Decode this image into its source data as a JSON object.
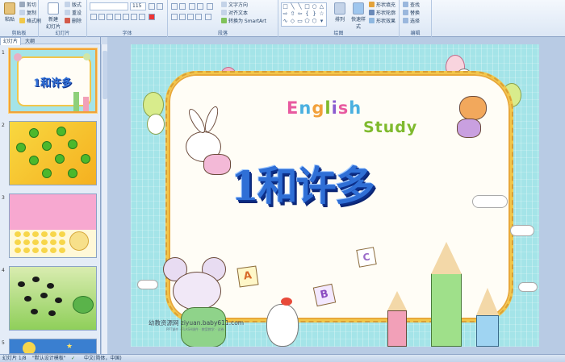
{
  "ribbon": {
    "clipboard": {
      "paste": "粘贴",
      "cut": "剪切",
      "copy": "复制",
      "format_painter": "格式刷",
      "label": "剪贴板"
    },
    "slides": {
      "new_slide": "新建\n幻灯片",
      "layout": "版式",
      "reset": "重设",
      "delete": "删除",
      "label": "幻灯片"
    },
    "font": {
      "size": "115",
      "label": "字体"
    },
    "paragraph": {
      "text_direction": "文字方向",
      "align_text": "对齐文本",
      "smartart": "转换为 SmartArt",
      "label": "段落"
    },
    "drawing": {
      "arrange": "排列",
      "quick_styles": "快速样式",
      "shape_fill": "形状填充",
      "shape_outline": "形状轮廓",
      "shape_effects": "形状效果",
      "label": "绘图"
    },
    "editing": {
      "find": "查找",
      "replace": "替换",
      "select": "选择",
      "label": "编辑"
    }
  },
  "pane": {
    "tabs": [
      "幻灯片",
      "大纲"
    ],
    "thumbnails": [
      {
        "num": "1",
        "title": "1和许多"
      },
      {
        "num": "2"
      },
      {
        "num": "3"
      },
      {
        "num": "4"
      },
      {
        "num": "5"
      }
    ]
  },
  "slide": {
    "english": "English",
    "study": "Study",
    "title": "1和许多",
    "cards": [
      "A",
      "B",
      "C"
    ],
    "watermark": "幼教资源网 ziyuan.baby611.com",
    "watermark_sub": "PPT课件 · FLASH课件 · 教案教学 · 试卷"
  },
  "status": {
    "slide_info": "幻灯片 1/8",
    "theme": "\"默认设计模板\"",
    "language": "中文(简体，中国)"
  },
  "colors": {
    "accent": "#2f6fd6",
    "frame": "#f2c64a",
    "slide_bg": "#a4e4e8"
  }
}
